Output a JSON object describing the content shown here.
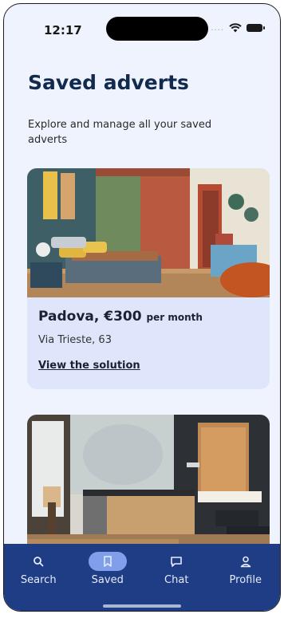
{
  "status_bar": {
    "time": "12:17",
    "dots": "...."
  },
  "header": {
    "title": "Saved adverts",
    "subtitle": "Explore and manage all your saved adverts"
  },
  "listings": [
    {
      "city": "Padova,",
      "price": "€300",
      "period": "per month",
      "address": "Via Trieste, 63",
      "link_label": "View the solution"
    }
  ],
  "nav": {
    "items": [
      {
        "label": "Search",
        "icon": "search-icon"
      },
      {
        "label": "Saved",
        "icon": "bookmark-icon",
        "active": true
      },
      {
        "label": "Chat",
        "icon": "chat-icon"
      },
      {
        "label": "Profile",
        "icon": "person-icon"
      }
    ]
  },
  "colors": {
    "background": "#eef3fd",
    "title": "#132a4f",
    "card": "#dfe6fb",
    "nav": "#1e3d85",
    "nav_active": "#7f9fea"
  }
}
